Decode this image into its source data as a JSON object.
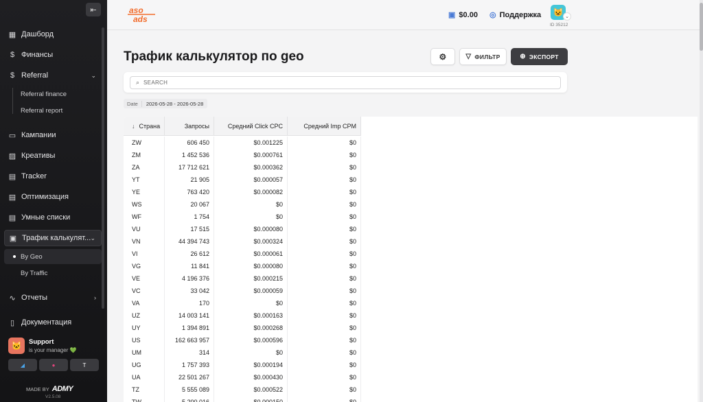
{
  "sidebar": {
    "collapse_icon": "collapse-left-icon",
    "items": [
      {
        "label": "Дашборд",
        "icon": "grid-icon",
        "glyph": "▦"
      },
      {
        "label": "Финансы",
        "icon": "dollar-icon",
        "glyph": "$"
      },
      {
        "label": "Referral",
        "icon": "dollar-icon",
        "glyph": "$"
      },
      {
        "label": "Кампании",
        "icon": "monitor-icon",
        "glyph": "▭"
      },
      {
        "label": "Креативы",
        "icon": "image-icon",
        "glyph": "▨"
      },
      {
        "label": "Tracker",
        "icon": "document-icon",
        "glyph": "▤"
      },
      {
        "label": "Оптимизация",
        "icon": "document-icon",
        "glyph": "▤"
      },
      {
        "label": "Умные списки",
        "icon": "document-icon",
        "glyph": "▤"
      },
      {
        "label": "Трафик калькулят...",
        "icon": "calculator-icon",
        "glyph": "▣"
      },
      {
        "label": "Отчеты",
        "icon": "activity-icon",
        "glyph": "∿"
      },
      {
        "label": "Документация",
        "icon": "book-icon",
        "glyph": "▯"
      }
    ],
    "referral_sub": [
      {
        "label": "Referral finance"
      },
      {
        "label": "Referral report"
      }
    ],
    "traffic_sub": [
      {
        "label": "By Geo"
      },
      {
        "label": "By Traffic"
      }
    ],
    "support": {
      "title": "Support",
      "subtitle": "is your manager 💚"
    },
    "made_by": "MADE BY",
    "brand": "ADMY",
    "version": "V2.5.08"
  },
  "header": {
    "logo_top": "aso",
    "logo_bottom": "ads",
    "balance": "$0.00",
    "support_label": "Поддержка",
    "user_id": "ID 35212"
  },
  "main": {
    "title": "Трафик калькулятор по geo",
    "filter_label": "ФИЛЬТР",
    "export_label": "ЭКСПОРТ",
    "search_placeholder": "SEARCH",
    "date_label": "Date",
    "date_value": "2026-05-28 - 2026-05-28"
  },
  "table": {
    "columns": [
      "Страна",
      "Запросы",
      "Средний Click CPC",
      "Средний Imp CPM"
    ],
    "rows": [
      [
        "ZW",
        "606 450",
        "$0.001225",
        "$0"
      ],
      [
        "ZM",
        "1 452 536",
        "$0.000761",
        "$0"
      ],
      [
        "ZA",
        "17 712 621",
        "$0.000362",
        "$0"
      ],
      [
        "YT",
        "21 905",
        "$0.000057",
        "$0"
      ],
      [
        "YE",
        "763 420",
        "$0.000082",
        "$0"
      ],
      [
        "WS",
        "20 067",
        "$0",
        "$0"
      ],
      [
        "WF",
        "1 754",
        "$0",
        "$0"
      ],
      [
        "VU",
        "17 515",
        "$0.000080",
        "$0"
      ],
      [
        "VN",
        "44 394 743",
        "$0.000324",
        "$0"
      ],
      [
        "VI",
        "26 612",
        "$0.000061",
        "$0"
      ],
      [
        "VG",
        "11 841",
        "$0.000080",
        "$0"
      ],
      [
        "VE",
        "4 196 376",
        "$0.000215",
        "$0"
      ],
      [
        "VC",
        "33 042",
        "$0.000059",
        "$0"
      ],
      [
        "VA",
        "170",
        "$0",
        "$0"
      ],
      [
        "UZ",
        "14 003 141",
        "$0.000163",
        "$0"
      ],
      [
        "UY",
        "1 394 891",
        "$0.000268",
        "$0"
      ],
      [
        "US",
        "162 663 957",
        "$0.000596",
        "$0"
      ],
      [
        "UM",
        "314",
        "$0",
        "$0"
      ],
      [
        "UG",
        "1 757 393",
        "$0.000194",
        "$0"
      ],
      [
        "UA",
        "22 501 267",
        "$0.000430",
        "$0"
      ],
      [
        "TZ",
        "5 555 089",
        "$0.000522",
        "$0"
      ],
      [
        "TW",
        "5 200 016",
        "$0.000150",
        "$0"
      ]
    ]
  }
}
